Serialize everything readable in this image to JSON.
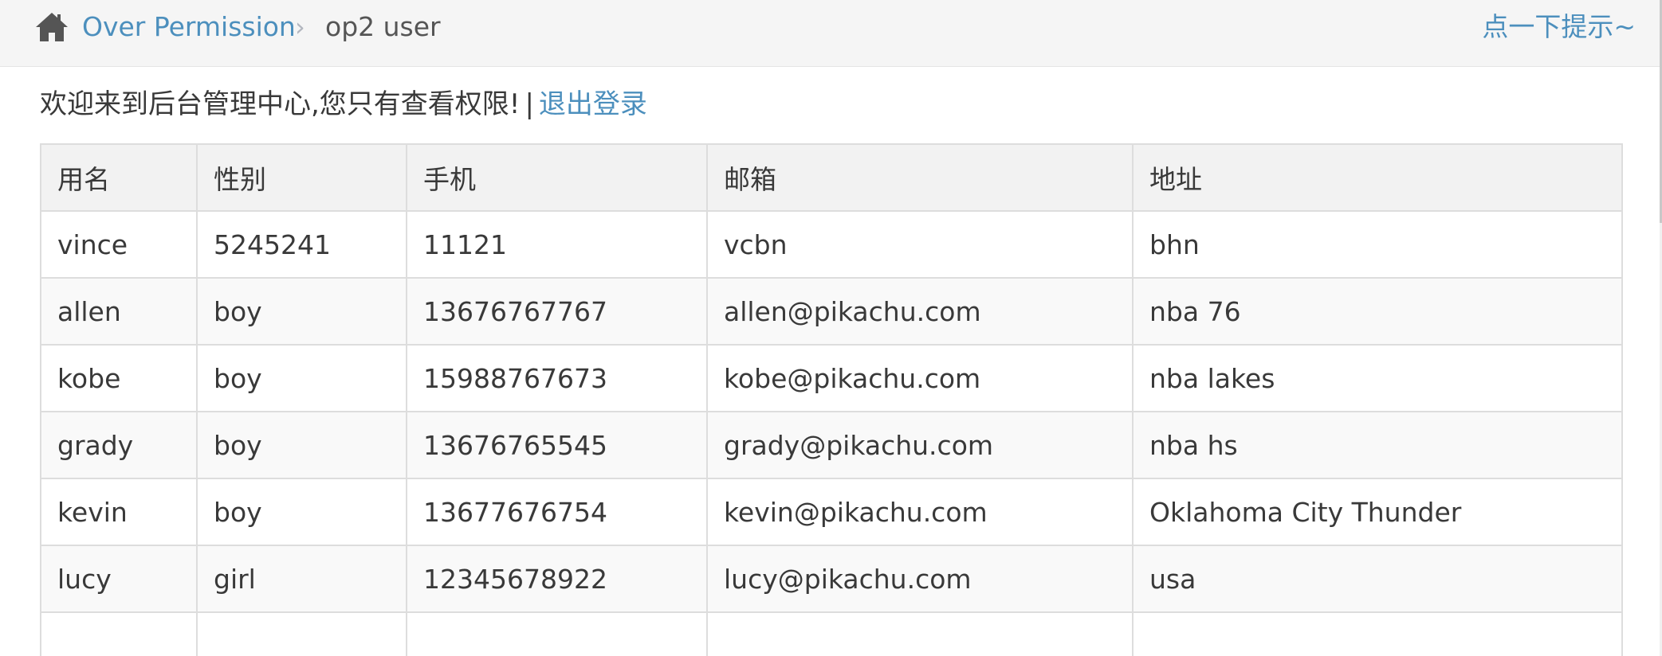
{
  "breadcrumb": {
    "home_icon": "home-icon",
    "section": "Over Permission",
    "separator": "›",
    "current": "op2 user"
  },
  "hint_link": "点一下提示~",
  "welcome": {
    "text": "欢迎来到后台管理中心,您只有查看权限!",
    "separator": "|",
    "logout": "退出登录"
  },
  "table": {
    "headers": [
      "用名",
      "性别",
      "手机",
      "邮箱",
      "地址"
    ],
    "rows": [
      [
        "vince",
        "5245241",
        "11121",
        "vcbn",
        "bhn"
      ],
      [
        "allen",
        "boy",
        "13676767767",
        "allen@pikachu.com",
        "nba 76"
      ],
      [
        "kobe",
        "boy",
        "15988767673",
        "kobe@pikachu.com",
        "nba lakes"
      ],
      [
        "grady",
        "boy",
        "13676765545",
        "grady@pikachu.com",
        "nba hs"
      ],
      [
        "kevin",
        "boy",
        "13677676754",
        "kevin@pikachu.com",
        "Oklahoma City Thunder"
      ],
      [
        "lucy",
        "girl",
        "12345678922",
        "lucy@pikachu.com",
        "usa"
      ]
    ]
  },
  "colors": {
    "link": "#4c8fbd",
    "text": "#393939",
    "breadcrumb_bg": "#f5f5f5",
    "border": "#dddddd"
  }
}
